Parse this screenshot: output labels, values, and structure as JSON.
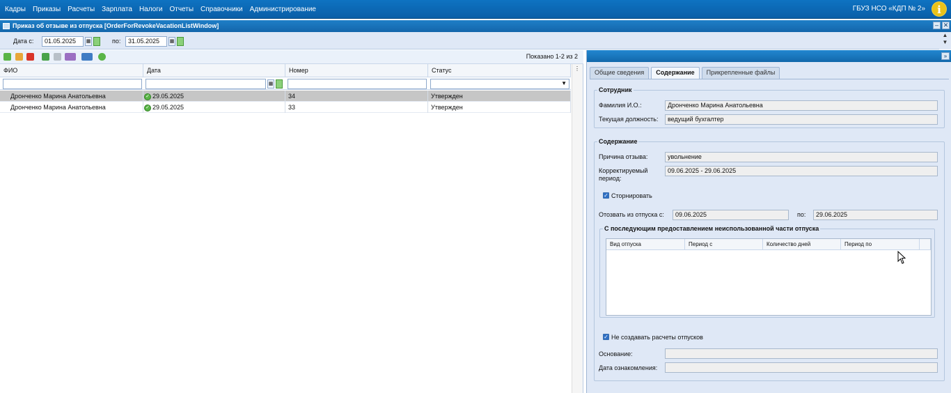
{
  "menu": [
    "Кадры",
    "Приказы",
    "Расчеты",
    "Зарплата",
    "Налоги",
    "Отчеты",
    "Справочники",
    "Администрирование"
  ],
  "org": "ГБУЗ НСО «КДП № 2»",
  "window_title": "Приказ об отзыве из отпуска [OrderForRevokeVacationListWindow]",
  "date_filter": {
    "from_label": "Дата с:",
    "from_value": "01.05.2025",
    "to_label": "по:",
    "to_value": "31.05.2025"
  },
  "grid": {
    "shown": "Показано 1-2 из 2",
    "columns": [
      "ФИО",
      "Дата",
      "Номер",
      "Статус"
    ],
    "rows": [
      {
        "fio": "Дронченко Марина Анатольевна",
        "date": "29.05.2025",
        "number": "34",
        "status": "Утвержден"
      },
      {
        "fio": "Дронченко Марина Анатольевна",
        "date": "29.05.2025",
        "number": "33",
        "status": "Утвержден"
      }
    ]
  },
  "tabs": [
    "Общие сведения",
    "Содержание",
    "Прикрепленные файлы"
  ],
  "employee": {
    "legend": "Сотрудник",
    "name_label": "Фамилия И.О.:",
    "name_value": "Дронченко Марина Анатольевна",
    "position_label": "Текущая должность:",
    "position_value": "ведущий бухгалтер"
  },
  "content": {
    "legend": "Содержание",
    "reason_label": "Причина отзыва:",
    "reason_value": "увольнение",
    "period_label": "Корректируемый период:",
    "period_value": "09.06.2025 - 29.06.2025",
    "storno_label": "Сторнировать",
    "revoke_from_label": "Отозвать из отпуска с:",
    "revoke_from_value": "09.06.2025",
    "revoke_to_label": "по:",
    "revoke_to_value": "29.06.2025",
    "sub_legend": "С последующим предоставлением неиспользованной части отпуска",
    "sub_columns": [
      "Вид отпуска",
      "Период с",
      "Количество дней",
      "Период по"
    ],
    "no_calc_label": "Не создавать расчеты отпусков",
    "basis_label": "Основание:",
    "basis_value": "",
    "ack_label": "Дата ознакомления:",
    "ack_value": ""
  }
}
